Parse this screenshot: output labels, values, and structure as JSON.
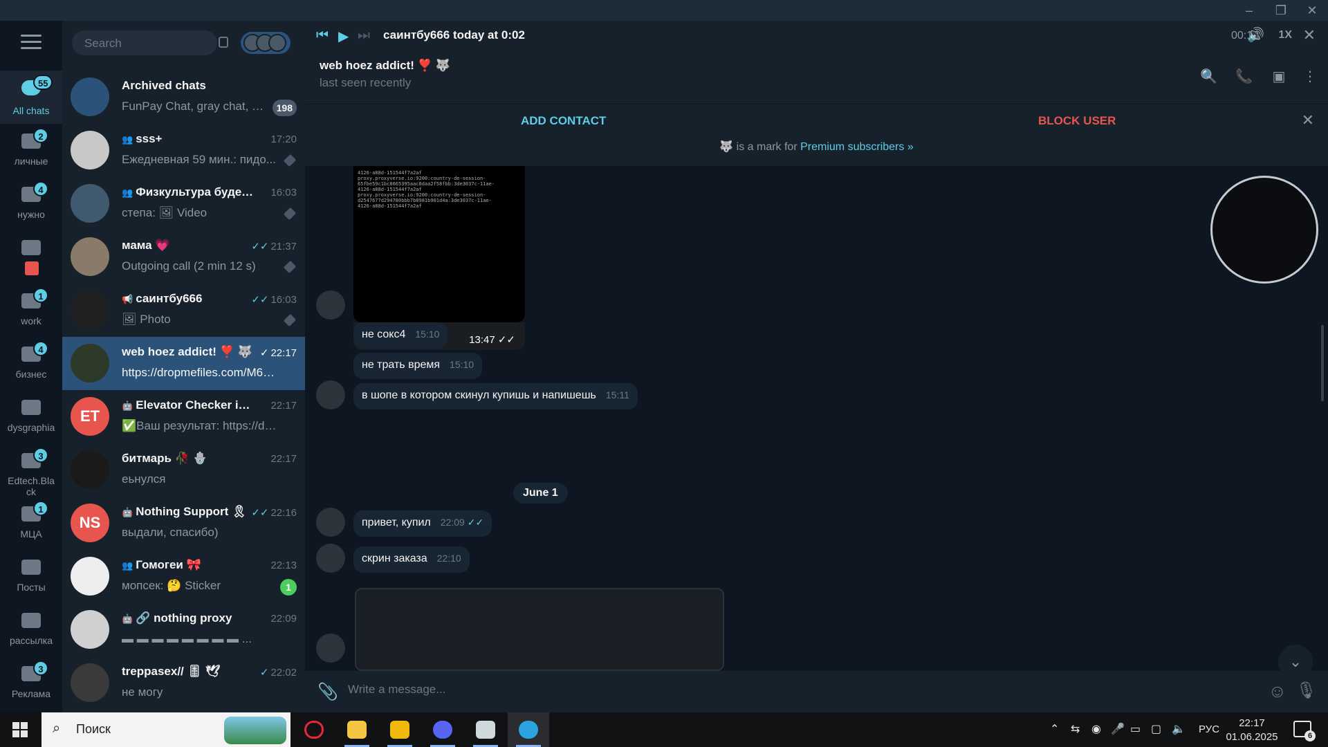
{
  "folders": [
    {
      "label": "All chats",
      "badge": "55",
      "active": true
    },
    {
      "label": "личные",
      "badge": "2"
    },
    {
      "label": "нужно",
      "badge": "4"
    },
    {
      "label": "",
      "badge": ""
    },
    {
      "label": "work",
      "badge": "1"
    },
    {
      "label": "бизнес",
      "badge": "4"
    },
    {
      "label": "dysgraphia",
      "badge": ""
    },
    {
      "label": "Edtech.Black",
      "badge": "3"
    },
    {
      "label": "МЦА",
      "badge": "1"
    },
    {
      "label": "Посты",
      "badge": ""
    },
    {
      "label": "рассылка",
      "badge": ""
    },
    {
      "label": "Реклама",
      "badge": "3"
    }
  ],
  "search": {
    "placeholder": "Search"
  },
  "chats": [
    {
      "name": "Archived chats",
      "preview": "FunPay Chat, gray chat, B...",
      "time": "",
      "badge": "198"
    },
    {
      "name": "sss+",
      "preview": "Ежедневная 59 мин.: пидо...",
      "time": "17:20",
      "group": true
    },
    {
      "name": "Физкультура будет ...",
      "preview": "степа: 🖼 Video",
      "time": "16:03",
      "group": true
    },
    {
      "name": "мама 💗",
      "preview": "Outgoing call (2 min 12 s)",
      "time": "21:37",
      "check": "✓✓"
    },
    {
      "name": "саинтбу666",
      "preview": "🖼 Photo",
      "time": "16:03",
      "check": "✓✓",
      "channel": true
    },
    {
      "name": "web hoez addict! ❣️ 🐺",
      "preview": "https://dropmefiles.com/M6EWD",
      "time": "22:17",
      "check": "✓",
      "selected": true
    },
    {
      "name": "Elevator Checker in TG",
      "preview": "✅Ваш результат: https://drop...",
      "time": "22:17",
      "initials": "ET",
      "color": "#e8554e",
      "bot": true
    },
    {
      "name": "битмарь 🥀 🪬",
      "preview": "еьнулся",
      "time": "22:17"
    },
    {
      "name": "Nothing Support 🎗",
      "preview": "выдали, спасибо)",
      "time": "22:16",
      "check": "✓✓",
      "initials": "NS",
      "color": "#e8554e",
      "bot": true
    },
    {
      "name": "Гомогеи 🎀",
      "preview": "мопсек: 🤔 Sticker",
      "time": "22:13",
      "group": true,
      "badge": "1",
      "badge_green": true
    },
    {
      "name": "🔗 nothing proxy",
      "preview": "▬ ▬ ▬ ▬ ▬ ▬ ▬ ▬ ...",
      "time": "22:09",
      "bot": true
    },
    {
      "name": "treppasex// 🎚 🕊",
      "preview": "не могу",
      "time": "22:02",
      "check": "✓"
    }
  ],
  "player": {
    "title": "саинтбу666 today at 0:02",
    "time": "00:12",
    "speed": "1X"
  },
  "peer": {
    "name": "web hoez addict! ❣️ 🐺",
    "status": "last seen recently"
  },
  "actions": {
    "add": "ADD CONTACT",
    "block": "BLOCK USER"
  },
  "premium": {
    "text": "is a mark for",
    "link": "Premium subscribers »"
  },
  "media1": {
    "time": "13:47",
    "check": "✓✓",
    "code": "4126-a88d-151544f7a2af\nproxy.proxyverse.io:9200:country-de-session-\n65fbe59c1bc8665395aac8daa2f58fbb:3de3037c-11ae-\n4126-a88d-151544f7a2af\nproxy.proxyverse.io:9200:country-de-session-\nd2547677d294780bbb7b8981b901d4a:3de3037c-11ae-\n4126-a88d-151544f7a2af"
  },
  "messages": [
    {
      "text": "не сокс4",
      "time": "15:10"
    },
    {
      "text": "не трать время",
      "time": "15:10"
    },
    {
      "text": "в шопе в котором скинул купишь и напишешь",
      "time": "15:11"
    },
    {
      "text": "привет, купил",
      "time": "22:09",
      "check": "✓✓"
    },
    {
      "text": "скрин заказа",
      "time": "22:10"
    }
  ],
  "date_pill": "June 1",
  "composer": {
    "placeholder": "Write a message..."
  },
  "taskbar": {
    "search": "Поиск",
    "lang": "РУС",
    "time": "22:17",
    "date": "01.06.2025",
    "notifications": "6"
  },
  "colors": {
    "accent": "#5fcde4",
    "selected": "#2b5278",
    "danger": "#e8554e",
    "bg": "#0e1621",
    "panel": "#17212b"
  }
}
